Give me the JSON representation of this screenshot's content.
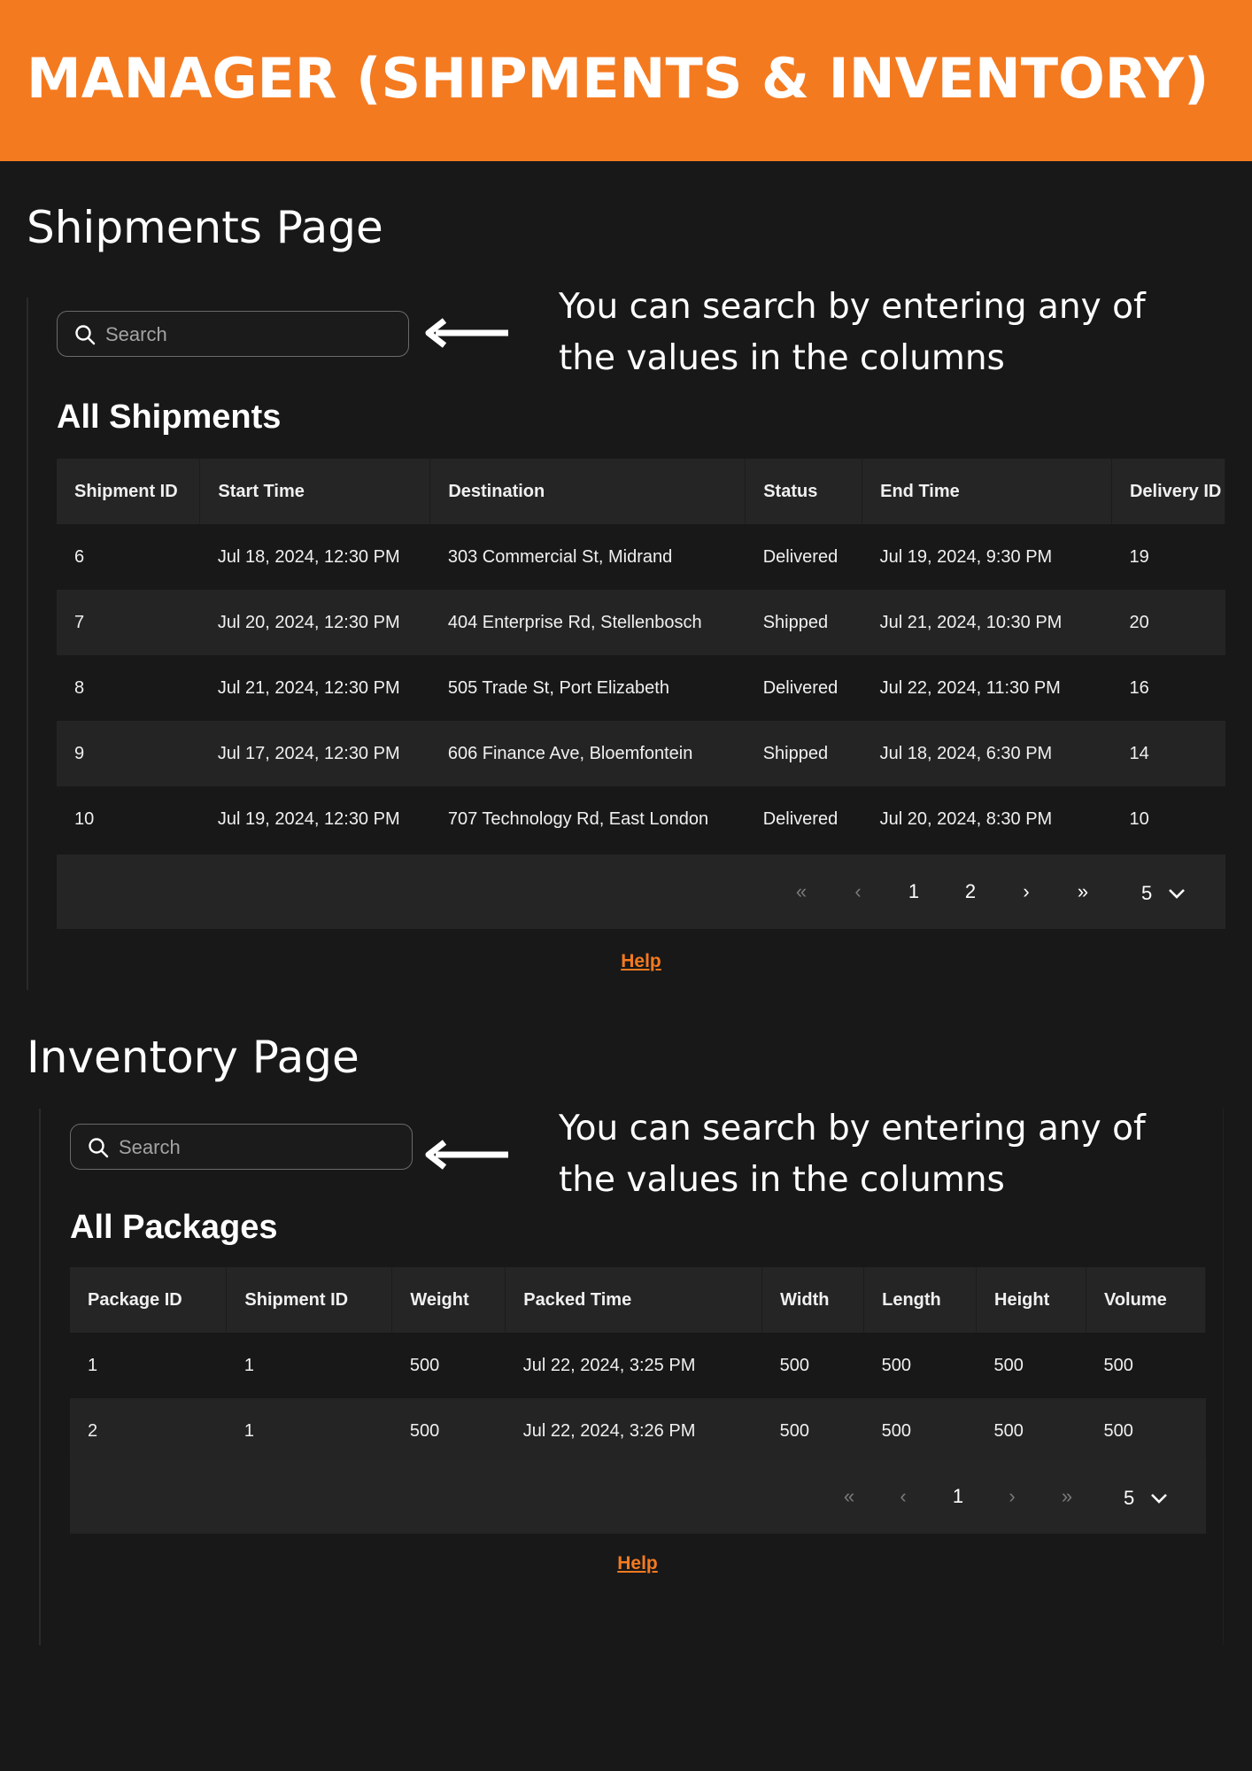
{
  "banner": {
    "title": "MANAGER (SHIPMENTS & INVENTORY)"
  },
  "colors": {
    "accent": "#f47a20",
    "background": "#181818",
    "header_row": "#252525"
  },
  "shipments": {
    "section_title": "Shipments Page",
    "search": {
      "placeholder": "Search"
    },
    "hint": "You can search by entering any of the values in the columns",
    "table_title": "All Shipments",
    "columns": [
      "Shipment ID",
      "Start Time",
      "Destination",
      "Status",
      "End Time",
      "Delivery ID"
    ],
    "rows": [
      [
        "6",
        "Jul 18, 2024, 12:30 PM",
        "303 Commercial St, Midrand",
        "Delivered",
        "Jul 19, 2024, 9:30 PM",
        "19"
      ],
      [
        "7",
        "Jul 20, 2024, 12:30 PM",
        "404 Enterprise Rd, Stellenbosch",
        "Shipped",
        "Jul 21, 2024, 10:30 PM",
        "20"
      ],
      [
        "8",
        "Jul 21, 2024, 12:30 PM",
        "505 Trade St, Port Elizabeth",
        "Delivered",
        "Jul 22, 2024, 11:30 PM",
        "16"
      ],
      [
        "9",
        "Jul 17, 2024, 12:30 PM",
        "606 Finance Ave, Bloemfontein",
        "Shipped",
        "Jul 18, 2024, 6:30 PM",
        "14"
      ],
      [
        "10",
        "Jul 19, 2024, 12:30 PM",
        "707 Technology Rd, East London",
        "Delivered",
        "Jul 20, 2024, 8:30 PM",
        "10"
      ]
    ],
    "pagination": {
      "first": "«",
      "prev": "‹",
      "pages": [
        "1",
        "2"
      ],
      "next": "›",
      "last": "»",
      "page_size": "5"
    },
    "help": "Help"
  },
  "inventory": {
    "section_title": "Inventory Page",
    "search": {
      "placeholder": "Search"
    },
    "hint": "You can search by entering any of the values in the columns",
    "table_title": "All Packages",
    "columns": [
      "Package ID",
      "Shipment ID",
      "Weight",
      "Packed Time",
      "Width",
      "Length",
      "Height",
      "Volume"
    ],
    "rows": [
      [
        "1",
        "1",
        "500",
        "Jul 22, 2024, 3:25 PM",
        "500",
        "500",
        "500",
        "500"
      ],
      [
        "2",
        "1",
        "500",
        "Jul 22, 2024, 3:26 PM",
        "500",
        "500",
        "500",
        "500"
      ]
    ],
    "pagination": {
      "first": "«",
      "prev": "‹",
      "pages": [
        "1"
      ],
      "next": "›",
      "last": "»",
      "page_size": "5"
    },
    "help": "Help"
  }
}
